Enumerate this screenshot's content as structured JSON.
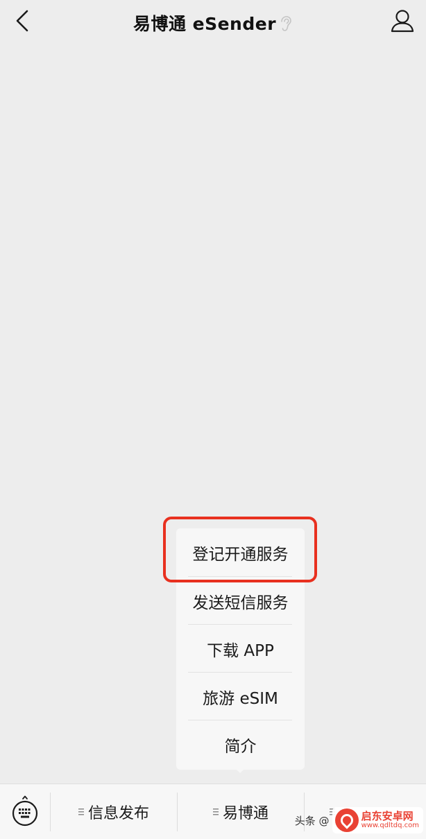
{
  "header": {
    "title": "易博通 eSender",
    "back_icon": "chevron-left-icon",
    "profile_icon": "person-icon",
    "ear_icon": "ear-icon"
  },
  "popup_menu": {
    "items": [
      {
        "label": "登记开通服务",
        "highlighted": true
      },
      {
        "label": "发送短信服务"
      },
      {
        "label": "下载 APP"
      },
      {
        "label": "旅游 eSIM"
      },
      {
        "label": "简介"
      }
    ]
  },
  "bottom_bar": {
    "keyboard_icon": "keyboard-icon",
    "tabs": [
      {
        "label": "信息发布"
      },
      {
        "label": "易博通"
      }
    ]
  },
  "watermark": {
    "prefix": "头条 @",
    "name": "启东安卓网",
    "url": "www.qdltdq.com"
  },
  "colors": {
    "background": "#ededed",
    "panel": "#f7f7f7",
    "highlight": "#e8301f",
    "watermark": "#e94234"
  }
}
